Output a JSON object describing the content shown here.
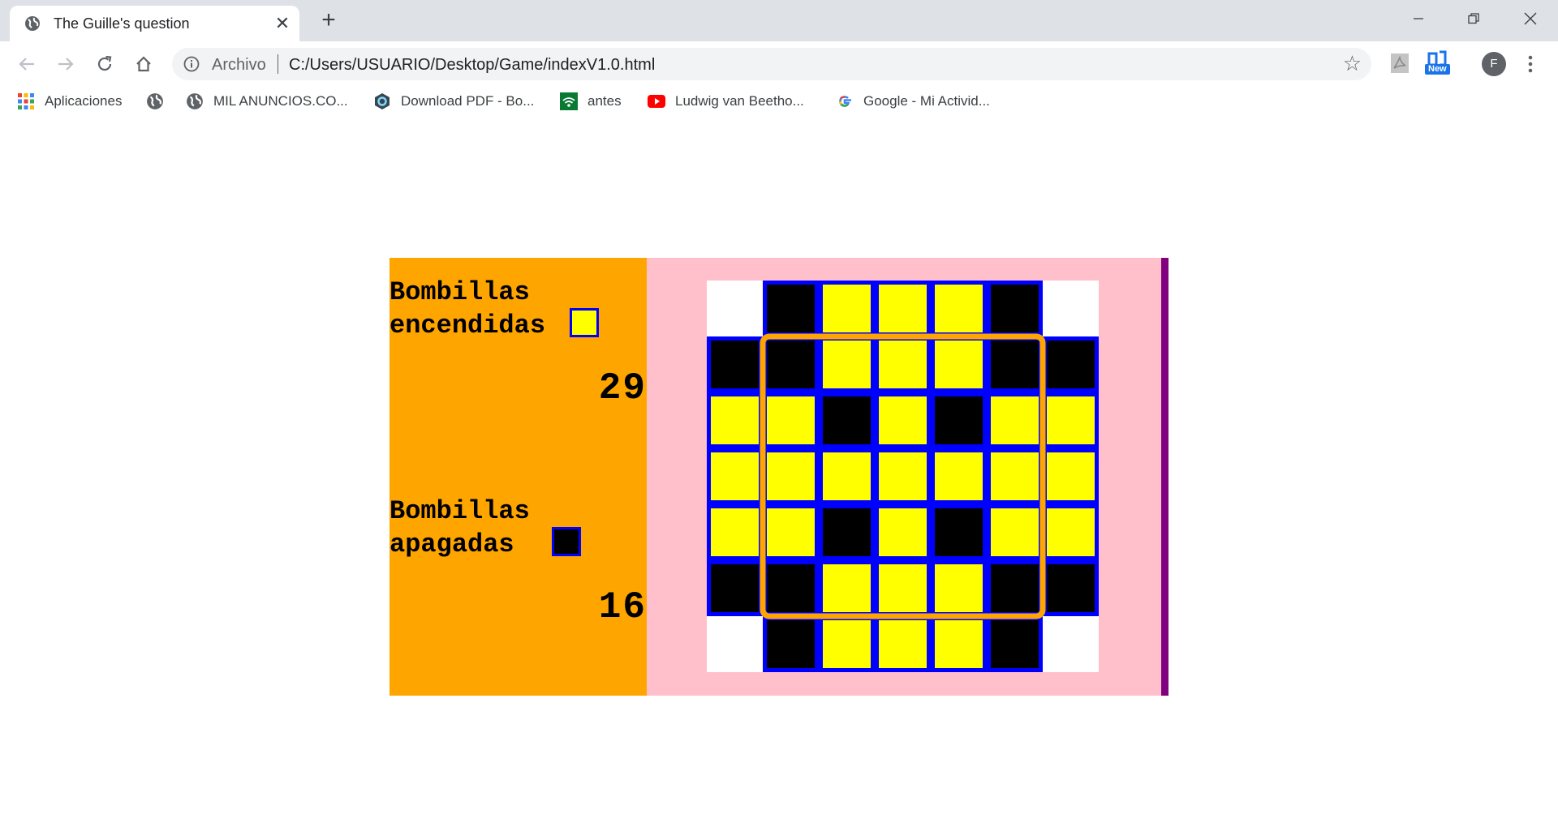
{
  "browser": {
    "tab_title": "The Guille's question",
    "address_scheme": "Archivo",
    "address_url": "C:/Users/USUARIO/Desktop/Game/indexV1.0.html",
    "profile_initial": "F",
    "extension_badge": "New"
  },
  "bookmarks": [
    {
      "label": "Aplicaciones",
      "icon": "apps-grid-icon"
    },
    {
      "label": "",
      "icon": "globe-icon"
    },
    {
      "label": "MIL ANUNCIOS.CO...",
      "icon": "globe-icon"
    },
    {
      "label": "Download PDF - Bo...",
      "icon": "hexagon-icon"
    },
    {
      "label": "antes",
      "icon": "wifi-icon"
    },
    {
      "label": "Ludwig van Beetho...",
      "icon": "youtube-icon"
    },
    {
      "label": "Google - Mi Activid...",
      "icon": "google-icon"
    }
  ],
  "game": {
    "lit_label": "Bombillas\nencendidas",
    "lit_count": "29",
    "off_label": "Bombillas\napagadas",
    "off_count": "16",
    "colors": {
      "lit": "#ffff00",
      "off": "#000000",
      "empty": "#ffffff",
      "grid": "#0000ff",
      "cursor": "#ffa500",
      "panel": "#ffa500",
      "board_bg": "#ffc0cb",
      "edge": "#800080"
    },
    "board": [
      [
        "empty",
        "off",
        "lit",
        "lit",
        "lit",
        "off",
        "empty"
      ],
      [
        "off",
        "off",
        "lit",
        "lit",
        "lit",
        "off",
        "off"
      ],
      [
        "lit",
        "lit",
        "off",
        "lit",
        "off",
        "lit",
        "lit"
      ],
      [
        "lit",
        "lit",
        "lit",
        "lit",
        "lit",
        "lit",
        "lit"
      ],
      [
        "lit",
        "lit",
        "off",
        "lit",
        "off",
        "lit",
        "lit"
      ],
      [
        "off",
        "off",
        "lit",
        "lit",
        "lit",
        "off",
        "off"
      ],
      [
        "empty",
        "off",
        "lit",
        "lit",
        "lit",
        "off",
        "empty"
      ]
    ],
    "highlight": {
      "row_start": 1,
      "row_end": 5,
      "col_start": 1,
      "col_end": 5
    }
  }
}
